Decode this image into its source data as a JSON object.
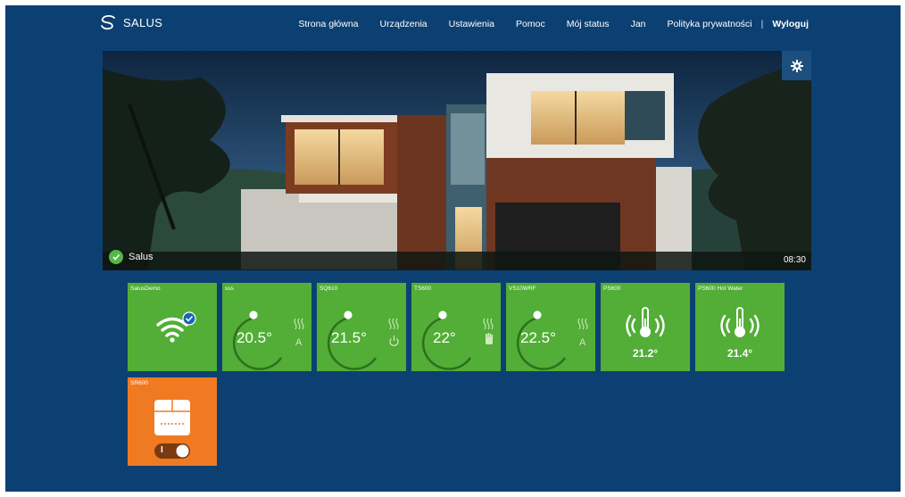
{
  "brand": {
    "name": "SALUS"
  },
  "nav": {
    "items": [
      "Strona główna",
      "Urządzenia",
      "Ustawienia",
      "Pomoc",
      "Mój status",
      "Jan",
      "Polityka prywatności"
    ],
    "separator": "|",
    "logout": "Wyloguj"
  },
  "hero": {
    "location_name": "Salus",
    "time": "08:30"
  },
  "tiles": [
    {
      "name": "SalusDemo",
      "kind": "gateway",
      "icon": "wifi-icon"
    },
    {
      "name": "sss",
      "kind": "thermostat",
      "temp": "20.5°",
      "mode_icon": "auto-icon"
    },
    {
      "name": "SQ610",
      "kind": "thermostat",
      "temp": "21.5°",
      "mode_icon": "power-icon"
    },
    {
      "name": "TS600",
      "kind": "thermostat",
      "temp": "22°",
      "mode_icon": "hand-icon"
    },
    {
      "name": "VS10WRF",
      "kind": "thermostat",
      "temp": "22.5°",
      "mode_icon": "auto-icon"
    },
    {
      "name": "PS600",
      "kind": "probe",
      "temp": "21.2°"
    },
    {
      "name": "PS600 Hot Water",
      "kind": "probe",
      "temp": "21.4°"
    },
    {
      "name": "SR600",
      "kind": "relay",
      "switch_label": "I"
    }
  ],
  "colors": {
    "background": "#0d4072",
    "tile_green": "#52ae36",
    "tile_orange": "#f07a22",
    "ok_green": "#54b848"
  }
}
